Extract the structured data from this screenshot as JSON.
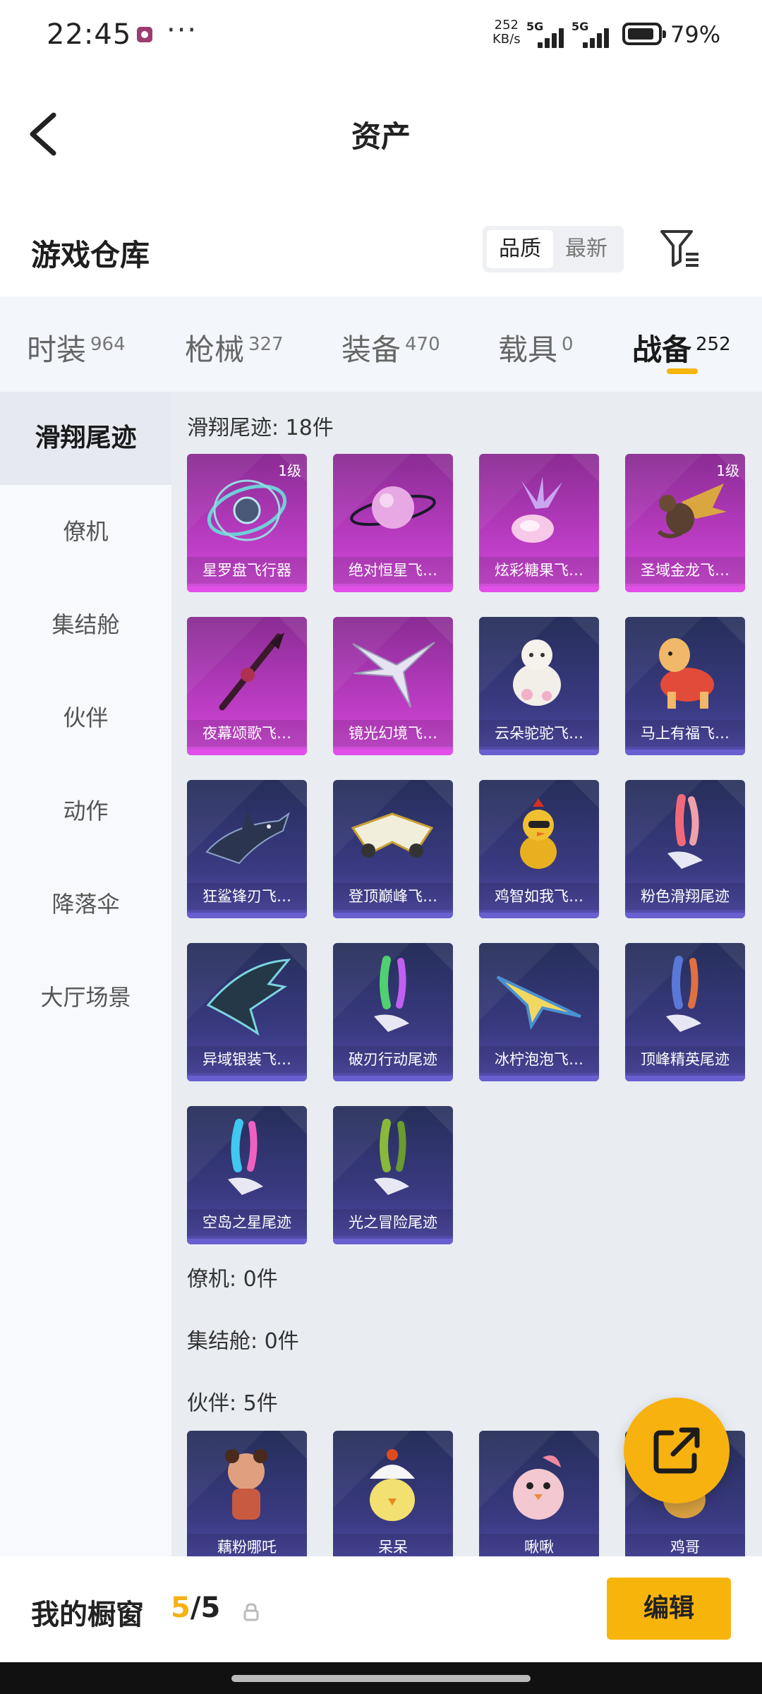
{
  "status": {
    "time": "22:45",
    "dots": "···",
    "speed_value": "252",
    "speed_unit": "KB/s",
    "net1": "5G",
    "net2": "5G",
    "battery": "79%"
  },
  "titlebar": {
    "title": "资产"
  },
  "header": {
    "title": "游戏仓库",
    "sort_options": [
      "品质",
      "最新"
    ],
    "sort_selected": "品质"
  },
  "tabs": [
    {
      "label": "时装",
      "count": "964"
    },
    {
      "label": "枪械",
      "count": "327"
    },
    {
      "label": "装备",
      "count": "470"
    },
    {
      "label": "载具",
      "count": "0"
    },
    {
      "label": "战备",
      "count": "252",
      "active": true
    }
  ],
  "sidenav": {
    "items": [
      "滑翔尾迹",
      "僚机",
      "集结舱",
      "伙伴",
      "动作",
      "降落伞",
      "大厅场景"
    ],
    "active_index": 0
  },
  "sections": [
    {
      "title": "滑翔尾迹: 18件",
      "items": [
        {
          "name": "星罗盘飞行器",
          "level": "1级",
          "rarity": "purple",
          "icon": "astrolabe-glider-icon"
        },
        {
          "name": "绝对恒星飞…",
          "level": "",
          "rarity": "purple",
          "icon": "planet-glider-icon"
        },
        {
          "name": "炫彩糖果飞…",
          "level": "",
          "rarity": "purple",
          "icon": "candy-glider-icon"
        },
        {
          "name": "圣域金龙飞…",
          "level": "1级",
          "rarity": "purple",
          "icon": "golden-dragon-icon"
        },
        {
          "name": "夜幕颂歌飞…",
          "level": "",
          "rarity": "purple",
          "icon": "staff-glider-icon"
        },
        {
          "name": "镜光幻境飞…",
          "level": "",
          "rarity": "purple",
          "icon": "crystal-wings-icon"
        },
        {
          "name": "云朵驼驼飞…",
          "level": "",
          "rarity": "blue",
          "icon": "alpaca-glider-icon"
        },
        {
          "name": "马上有福飞…",
          "level": "",
          "rarity": "blue",
          "icon": "horse-glider-icon"
        },
        {
          "name": "狂鲨锋刃飞…",
          "level": "",
          "rarity": "blue",
          "icon": "shark-glider-icon"
        },
        {
          "name": "登顶巅峰飞…",
          "level": "",
          "rarity": "blue",
          "icon": "jet-glider-icon"
        },
        {
          "name": "鸡智如我飞…",
          "level": "",
          "rarity": "blue",
          "icon": "chicken-glider-icon"
        },
        {
          "name": "粉色滑翔尾迹",
          "level": "",
          "rarity": "blue",
          "icon": "pink-trail-icon"
        },
        {
          "name": "异域银装飞…",
          "level": "",
          "rarity": "blue",
          "icon": "silver-wings-icon"
        },
        {
          "name": "破刃行动尾迹",
          "level": "",
          "rarity": "blue",
          "icon": "rainbow-trail-icon"
        },
        {
          "name": "冰柠泡泡飞…",
          "level": "",
          "rarity": "blue",
          "icon": "plane-glider-icon"
        },
        {
          "name": "顶峰精英尾迹",
          "level": "",
          "rarity": "blue",
          "icon": "elite-trail-icon"
        },
        {
          "name": "空岛之星尾迹",
          "level": "",
          "rarity": "blue",
          "icon": "star-trail-icon"
        },
        {
          "name": "光之冒险尾迹",
          "level": "",
          "rarity": "blue",
          "icon": "green-trail-icon"
        }
      ]
    },
    {
      "title": "僚机: 0件",
      "items": []
    },
    {
      "title": "集结舱: 0件",
      "items": []
    },
    {
      "title": "伙伴: 5件",
      "items": [
        {
          "name": "藕粉哪吒",
          "level": "",
          "rarity": "blue",
          "icon": "nezha-partner-icon"
        },
        {
          "name": "呆呆",
          "level": "",
          "rarity": "blue",
          "icon": "chick-partner-icon"
        },
        {
          "name": "啾啾",
          "level": "",
          "rarity": "blue",
          "icon": "bird-partner-icon"
        },
        {
          "name": "鸡哥",
          "level": "",
          "rarity": "blue",
          "icon": "rooster-partner-icon"
        }
      ]
    }
  ],
  "bottom": {
    "label": "我的橱窗",
    "current": "5",
    "total": "/5",
    "edit_label": "编辑"
  },
  "colors": {
    "accent": "#f7b50c",
    "purple_card": "#c03ec8",
    "blue_card": "#3a3a82"
  }
}
